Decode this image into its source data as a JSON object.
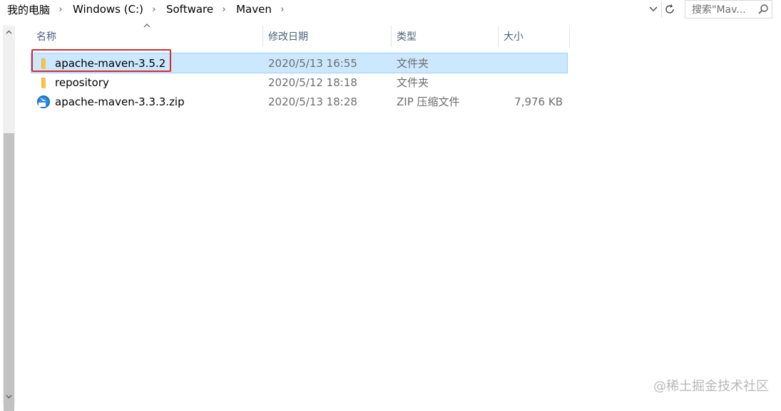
{
  "breadcrumb": {
    "items": [
      "我的电脑",
      "Windows (C:)",
      "Software",
      "Maven"
    ],
    "separator": "›"
  },
  "search": {
    "placeholder": "搜索\"Mav...",
    "icon": "search-icon"
  },
  "columns": {
    "name": "名称",
    "date": "修改日期",
    "type": "类型",
    "size": "大小"
  },
  "files": [
    {
      "name": "apache-maven-3.5.2",
      "date": "2020/5/13 16:55",
      "type": "文件夹",
      "size": "",
      "icon": "folder-icon",
      "selected": true
    },
    {
      "name": "repository",
      "date": "2020/5/12 18:18",
      "type": "文件夹",
      "size": "",
      "icon": "folder-icon",
      "selected": false
    },
    {
      "name": "apache-maven-3.3.3.zip",
      "date": "2020/5/13 18:28",
      "type": "ZIP 压缩文件",
      "size": "7,976 KB",
      "icon": "zip-archive-icon",
      "selected": false
    }
  ],
  "watermark": "@稀土掘金技术社区",
  "colors": {
    "selection_bg": "#cce8ff",
    "selection_border": "#99d1ff",
    "highlight_box": "#d62b2b",
    "folder": "#f4c44e",
    "header_text": "#4c607a"
  }
}
